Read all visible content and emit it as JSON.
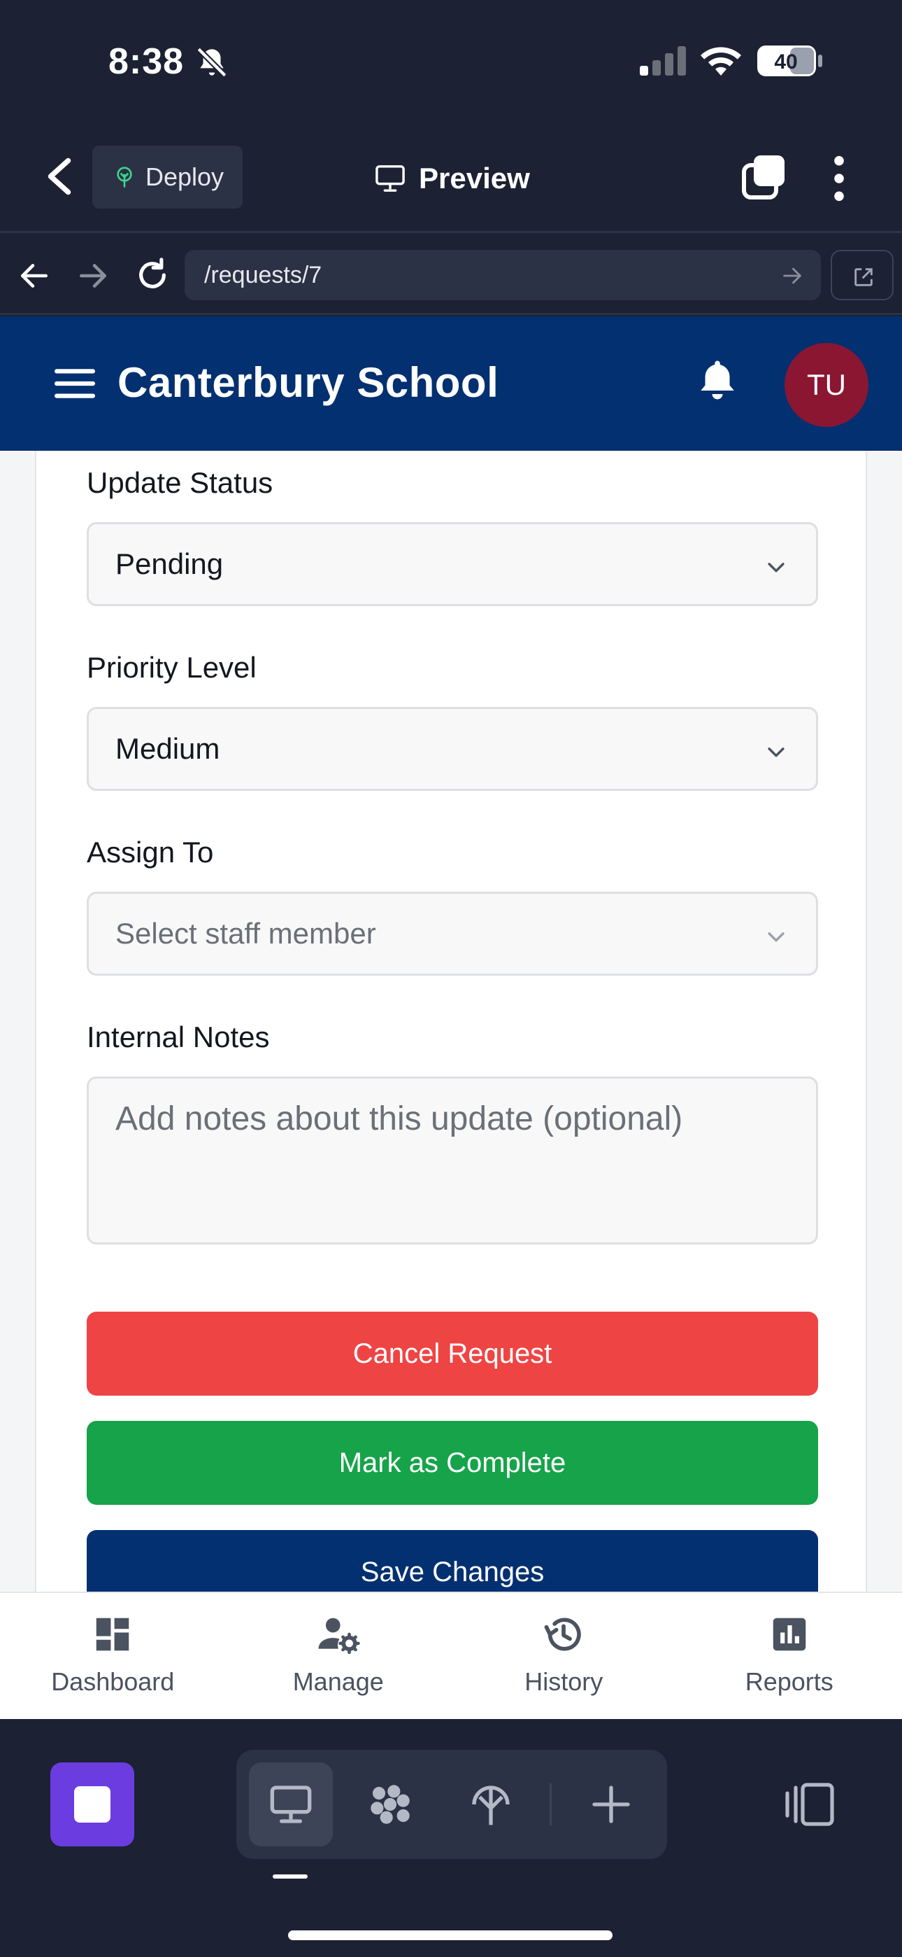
{
  "status_bar": {
    "time": "8:38",
    "battery": "40"
  },
  "app_bar": {
    "deploy_label": "Deploy",
    "preview_label": "Preview"
  },
  "browser": {
    "url": "/requests/7"
  },
  "site": {
    "title": "Canterbury School",
    "avatar_initials": "TU"
  },
  "form": {
    "status": {
      "label": "Update Status",
      "value": "Pending"
    },
    "priority": {
      "label": "Priority Level",
      "value": "Medium"
    },
    "assign": {
      "label": "Assign To",
      "placeholder": "Select staff member"
    },
    "notes": {
      "label": "Internal Notes",
      "placeholder": "Add notes about this update (optional)"
    },
    "buttons": {
      "cancel": "Cancel Request",
      "complete": "Mark as Complete",
      "save": "Save Changes"
    },
    "colors": {
      "cancel": "#ef4444",
      "complete": "#16a34a",
      "save": "#023070"
    }
  },
  "bottom_nav": [
    {
      "label": "Dashboard",
      "icon": "dashboard-icon"
    },
    {
      "label": "Manage",
      "icon": "manage-users-icon"
    },
    {
      "label": "History",
      "icon": "history-icon"
    },
    {
      "label": "Reports",
      "icon": "reports-icon"
    }
  ],
  "theme": {
    "brand": "#023070",
    "avatar": "#8a1632",
    "dock_accent": "#6b3ce0"
  }
}
